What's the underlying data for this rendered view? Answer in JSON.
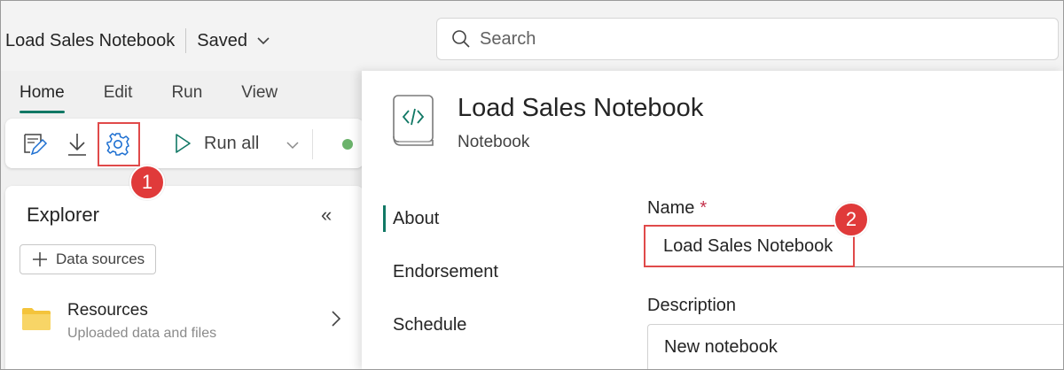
{
  "header": {
    "notebook_title": "Load Sales Notebook",
    "saved_label": "Saved",
    "search_placeholder": "Search"
  },
  "tabs": [
    {
      "label": "Home",
      "active": true
    },
    {
      "label": "Edit"
    },
    {
      "label": "Run"
    },
    {
      "label": "View"
    }
  ],
  "ribbon": {
    "run_all_label": "Run all",
    "icons": [
      "edit-icon",
      "download-icon",
      "settings-icon",
      "play-icon",
      "chevron-down-icon"
    ],
    "status_color": "#6bb36b"
  },
  "callouts": [
    "1",
    "2"
  ],
  "explorer": {
    "title": "Explorer",
    "collapse_glyph": "«",
    "data_sources_label": "Data sources",
    "resources": {
      "title": "Resources",
      "subtitle": "Uploaded data and files"
    }
  },
  "panel": {
    "title": "Load Sales Notebook",
    "type": "Notebook",
    "nav": [
      "About",
      "Endorsement",
      "Schedule"
    ],
    "active_nav": "About",
    "name_label": "Name",
    "required_mark": "*",
    "name_value": "Load Sales Notebook",
    "description_label": "Description",
    "description_value": "New notebook"
  },
  "colors": {
    "accent": "#117865",
    "highlight": "#e04a4a",
    "callout": "#e03a3a"
  }
}
